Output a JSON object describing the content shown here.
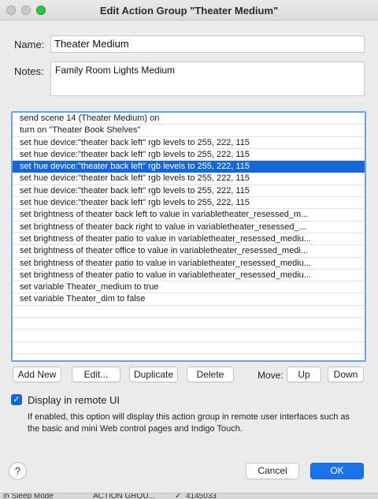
{
  "window": {
    "title": "Edit Action Group \"Theater Medium\""
  },
  "form": {
    "name_label": "Name:",
    "name_value": "Theater Medium",
    "notes_label": "Notes:",
    "notes_value": "Family Room Lights Medium"
  },
  "actions": [
    "send scene 14 (Theater Medium) on",
    "turn on \"Theater Book Shelves\"",
    "set hue device:\"theater back left\"  rgb levels to 255, 222, 115",
    "set hue device:\"theater back left\"  rgb levels to 255, 222, 115",
    "set hue device:\"theater back left\"  rgb levels to 255, 222, 115",
    "set hue device:\"theater back left\"  rgb levels to 255, 222, 115",
    "set hue device:\"theater back left\"  rgb levels to 255, 222, 115",
    "set hue device:\"theater back left\"  rgb levels to 255, 222, 115",
    "set brightness of theater back left to value in variabletheater_resessed_m...",
    "set brightness of theater back right to value in variabletheater_resessed_...",
    "set brightness of theater patio to value in variabletheater_resessed_mediu...",
    "set brightness of theater office to value in variabletheater_resessed_medi...",
    "set brightness of theater patio to value in variabletheater_resessed_mediu...",
    "set brightness of theater patio to value in variabletheater_resessed_mediu...",
    "set variable Theater_medium to true",
    "set variable Theater_dim to false"
  ],
  "selected_index": 4,
  "toolbar": {
    "add_new": "Add New",
    "edit": "Edit...",
    "duplicate": "Duplicate",
    "delete": "Delete",
    "move_label": "Move:",
    "up": "Up",
    "down": "Down"
  },
  "remote_ui": {
    "checked": true,
    "label": "Display in remote UI",
    "description": "If enabled, this option will display this action group in remote user interfaces such as the basic and mini Web control pages and Indigo Touch."
  },
  "footer": {
    "help": "?",
    "cancel": "Cancel",
    "ok": "OK"
  },
  "background_strip": {
    "col1": "in Sleep Mode",
    "col2": "ACTION GROU...",
    "col3": "4145033"
  },
  "colors": {
    "accent": "#1766d6",
    "list_border": "#6fa3e8",
    "ok": "#1a73e8"
  }
}
